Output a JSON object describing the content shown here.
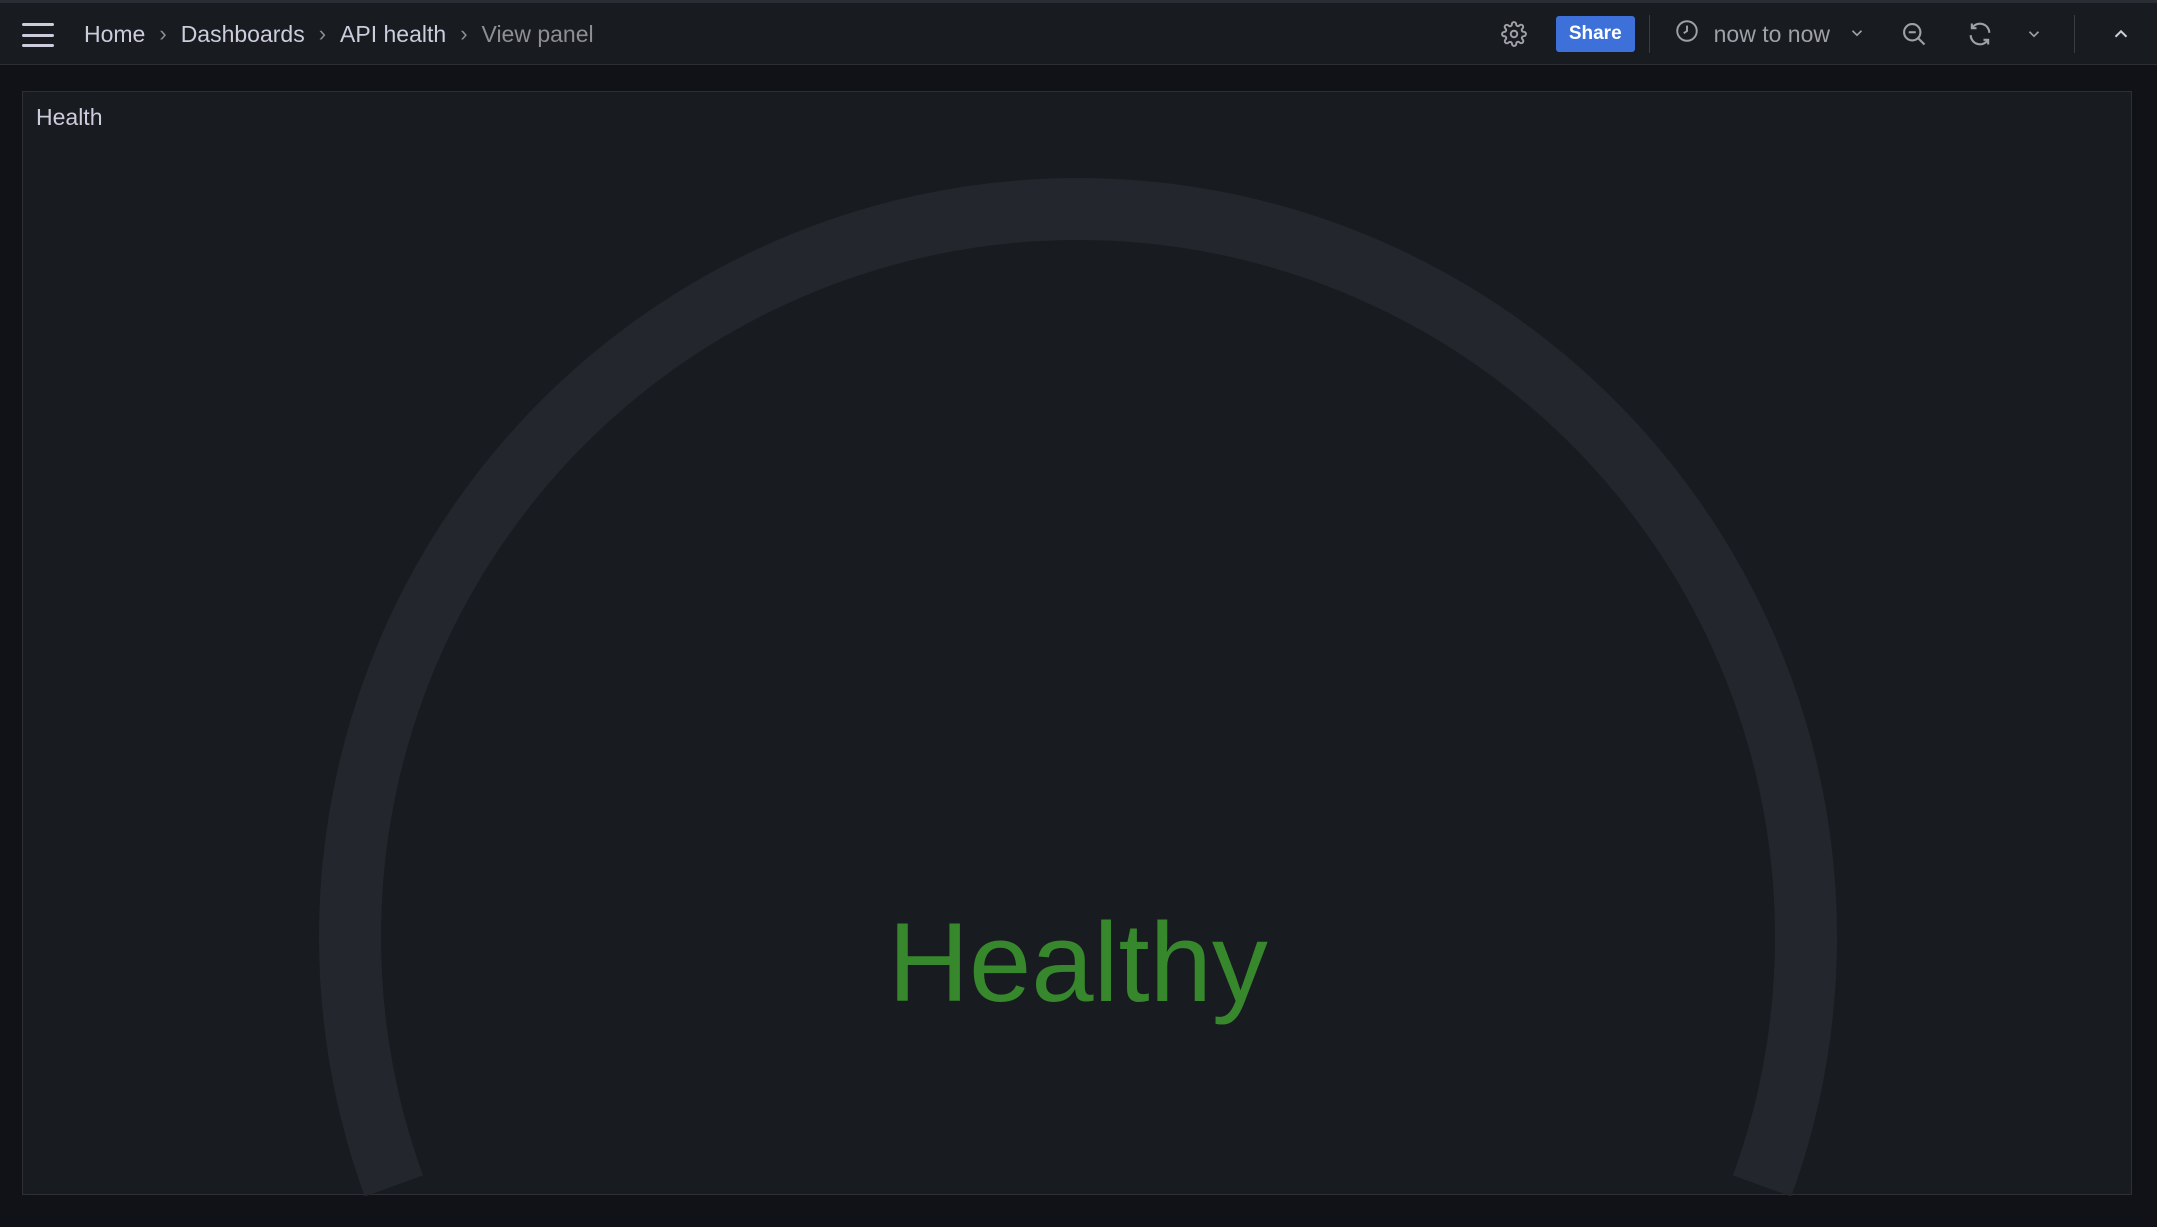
{
  "topbar": {
    "breadcrumb": [
      {
        "label": "Home"
      },
      {
        "label": "Dashboards"
      },
      {
        "label": "API health"
      },
      {
        "label": "View panel"
      }
    ],
    "separator": "›",
    "share_label": "Share",
    "time_range": "now to now",
    "icons": {
      "menu": "hamburger-icon",
      "settings": "gear-icon",
      "clock": "clock-icon",
      "zoom_out": "zoom-out-icon",
      "refresh": "refresh-icon",
      "chevron": "chevron-down-icon",
      "collapse": "chevron-up-icon"
    },
    "colors": {
      "share": "#3d71d9"
    }
  },
  "panel": {
    "title": "Health",
    "gauge": {
      "value_text": "Healthy",
      "value_color": "#37872d",
      "track_color": "#23262c"
    }
  }
}
